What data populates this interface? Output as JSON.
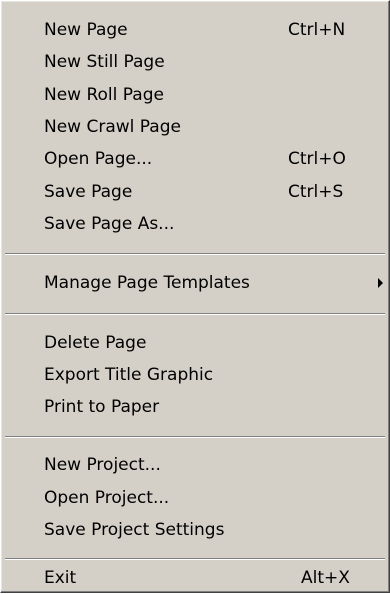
{
  "menu": {
    "items": [
      {
        "label": "New Page",
        "shortcut": "Ctrl+N"
      },
      {
        "label": "New Still Page",
        "shortcut": ""
      },
      {
        "label": "New Roll Page",
        "shortcut": ""
      },
      {
        "label": "New Crawl Page",
        "shortcut": ""
      },
      {
        "label": "Open Page...",
        "shortcut": "Ctrl+O"
      },
      {
        "label": "Save Page",
        "shortcut": "Ctrl+S"
      },
      {
        "label": "Save Page As...",
        "shortcut": ""
      },
      {
        "label": "Manage Page Templates",
        "shortcut": "",
        "submenu_icon": "submenu-arrow-icon"
      },
      {
        "label": "Delete Page",
        "shortcut": ""
      },
      {
        "label": "Export Title Graphic",
        "shortcut": ""
      },
      {
        "label": "Print to Paper",
        "shortcut": ""
      },
      {
        "label": "New Project...",
        "shortcut": ""
      },
      {
        "label": "Open Project...",
        "shortcut": ""
      },
      {
        "label": "Save Project Settings",
        "shortcut": ""
      },
      {
        "label": "Exit",
        "shortcut": "Alt+X"
      }
    ]
  },
  "colors": {
    "menu_background": "#d4d0c8",
    "text": "#000000",
    "separator_dark": "#808080",
    "separator_light": "#ffffff"
  }
}
